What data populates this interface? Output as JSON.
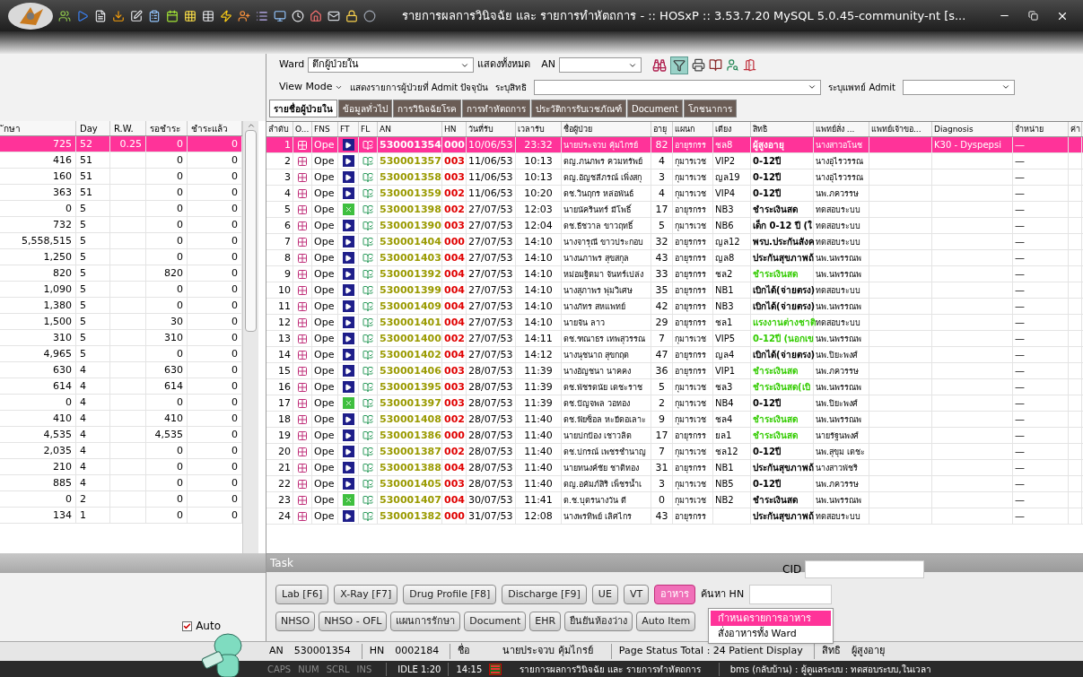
{
  "window": {
    "title": "รายการผลการวินิจฉัย และ รายการทำหัตถการ - :: HOSxP :: 3.53.7.20 MySQL 5.0.45-community-nt [s..."
  },
  "toolbar": {
    "ward_label": "Ward",
    "ward_value": "ตึกผู้ป่วยใน",
    "show_all": "แสดงทั้งหมด",
    "an_label": "AN",
    "filter_on": true,
    "view_mode": "View Mode",
    "admit_current": "แสดงรายการผู้ป่วยที่ Admit ปัจจุบัน",
    "right_label": "ระบุสิทธิ",
    "doctor_label": "ระบุแพทย์ Admit"
  },
  "tabs": [
    {
      "label": "รายชื่อผู้ป่วยใน",
      "selected": true
    },
    {
      "label": "ข้อมูลทั่วไป",
      "selected": false
    },
    {
      "label": "การวินิจฉัยโรค",
      "selected": false
    },
    {
      "label": "การทำหัตถการ",
      "selected": false
    },
    {
      "label": "ประวัติการรับเวชภัณฑ์",
      "selected": false
    },
    {
      "label": "Document",
      "selected": false
    },
    {
      "label": "โภชนาการ",
      "selected": false
    }
  ],
  "left_table": {
    "columns": [
      "ักษา",
      "Day",
      "R.W.",
      "รอชำระ",
      "ชำระแล้ว"
    ],
    "rows": [
      {
        "selected": true,
        "cells": [
          "725",
          "52",
          "0.25",
          "0",
          "0"
        ]
      },
      {
        "selected": false,
        "cells": [
          "416",
          "51",
          "",
          "0",
          "0"
        ]
      },
      {
        "selected": false,
        "cells": [
          "160",
          "51",
          "",
          "0",
          "0"
        ]
      },
      {
        "selected": false,
        "cells": [
          "363",
          "51",
          "",
          "0",
          "0"
        ]
      },
      {
        "selected": false,
        "cells": [
          "0",
          "5",
          "",
          "0",
          "0"
        ]
      },
      {
        "selected": false,
        "cells": [
          "732",
          "5",
          "",
          "0",
          "0"
        ]
      },
      {
        "selected": false,
        "cells": [
          "5,558,515",
          "5",
          "",
          "0",
          "0"
        ]
      },
      {
        "selected": false,
        "cells": [
          "1,250",
          "5",
          "",
          "0",
          "0"
        ]
      },
      {
        "selected": false,
        "cells": [
          "820",
          "5",
          "",
          "820",
          "0"
        ]
      },
      {
        "selected": false,
        "cells": [
          "1,090",
          "5",
          "",
          "0",
          "0"
        ]
      },
      {
        "selected": false,
        "cells": [
          "1,380",
          "5",
          "",
          "0",
          "0"
        ]
      },
      {
        "selected": false,
        "cells": [
          "1,500",
          "5",
          "",
          "30",
          "0"
        ]
      },
      {
        "selected": false,
        "cells": [
          "310",
          "5",
          "",
          "310",
          "0"
        ]
      },
      {
        "selected": false,
        "cells": [
          "4,965",
          "5",
          "",
          "0",
          "0"
        ]
      },
      {
        "selected": false,
        "cells": [
          "630",
          "4",
          "",
          "630",
          "0"
        ]
      },
      {
        "selected": false,
        "cells": [
          "614",
          "4",
          "",
          "614",
          "0"
        ]
      },
      {
        "selected": false,
        "cells": [
          "0",
          "4",
          "",
          "0",
          "0"
        ]
      },
      {
        "selected": false,
        "cells": [
          "410",
          "4",
          "",
          "410",
          "0"
        ]
      },
      {
        "selected": false,
        "cells": [
          "4,535",
          "4",
          "",
          "4,535",
          "0"
        ]
      },
      {
        "selected": false,
        "cells": [
          "2,035",
          "4",
          "",
          "0",
          "0"
        ]
      },
      {
        "selected": false,
        "cells": [
          "210",
          "4",
          "",
          "0",
          "0"
        ]
      },
      {
        "selected": false,
        "cells": [
          "885",
          "4",
          "",
          "0",
          "0"
        ]
      },
      {
        "selected": false,
        "cells": [
          "0",
          "2",
          "",
          "0",
          "0"
        ]
      },
      {
        "selected": false,
        "cells": [
          "134",
          "1",
          "",
          "0",
          "0"
        ]
      }
    ]
  },
  "table": {
    "columns": [
      "ลำดับ",
      "O...",
      "FNS",
      "FT",
      "FL",
      "AN",
      "HN",
      "วันที่รับ",
      "เวลารับ",
      "ชื่อผู้ป่วย",
      "อายุ",
      "แผนก",
      "เตียง",
      "สิทธิ",
      "แพทย์สั่ง ...",
      "แพทย์เจ้าขอ...",
      "Diagnosis",
      "จำหน่าย",
      "ค่า"
    ],
    "rows": [
      {
        "selected": true,
        "kind": "play",
        "no": "1",
        "fns": "Ope",
        "an": "530001354",
        "hn": "000",
        "date": "10/06/53",
        "time": "23:32",
        "name": "นายประจวบ คุ้มไกรย์",
        "age": "82",
        "dept": "อายุรกรร",
        "bed": "ชล8",
        "right": "ผู้สูงอายุ",
        "doctor": "นางสาวอโนช",
        "diagnosis": "K30 - Dyspepsi",
        "discharge": "—"
      },
      {
        "selected": false,
        "kind": "play",
        "no": "2",
        "fns": "Ope",
        "an": "530001357",
        "hn": "003",
        "date": "11/06/53",
        "time": "10:13",
        "name": "ดญ.ภนภพร ควมทรัพย์",
        "age": "4",
        "dept": "กุมารเวช",
        "bed": "VIP2",
        "right": "0-12ปี",
        "color": "#000000",
        "doctor": "นางอุไรวรรณ",
        "discharge": "—"
      },
      {
        "selected": false,
        "kind": "play",
        "no": "3",
        "fns": "Ope",
        "an": "530001358",
        "hn": "003",
        "date": "11/06/53",
        "time": "10:13",
        "name": "ดญ.อัญชลีภรณ์ เพิ่งสกุ",
        "age": "3",
        "dept": "กุมารเวช",
        "bed": "ญล19",
        "right": "0-12ปี",
        "color": "#000000",
        "doctor": "นางอุไรวรรณ",
        "discharge": "—"
      },
      {
        "selected": false,
        "kind": "play",
        "no": "4",
        "fns": "Ope",
        "an": "530001359",
        "hn": "002",
        "date": "11/06/53",
        "time": "10:20",
        "name": "ดช.วินฤกร หล่อพันธ์",
        "age": "4",
        "dept": "กุมารเวช",
        "bed": "VIP4",
        "right": "0-12ปี",
        "color": "#000000",
        "doctor": "นพ.ภควรรษ",
        "discharge": "—"
      },
      {
        "selected": false,
        "kind": "cross",
        "no": "5",
        "fns": "Ope",
        "an": "530001398",
        "hn": "002",
        "date": "27/07/53",
        "time": "12:03",
        "name": "นายนัครินทร์ มีโพธิ์",
        "age": "17",
        "dept": "อายุรกรร",
        "bed": "NB3",
        "right": "ชำระเงินสด",
        "color": "#000000",
        "doctor": "ทดสอบระบบ",
        "discharge": "—"
      },
      {
        "selected": false,
        "kind": "play",
        "no": "6",
        "fns": "Ope",
        "an": "530001390",
        "hn": "003",
        "date": "27/07/53",
        "time": "12:04",
        "name": "ดช.ธีชวาล ขาวฤทธิ์",
        "age": "5",
        "dept": "กุมารเวช",
        "bed": "NB6",
        "right": "เด็ก 0-12 ปี (ใ",
        "color": "#000000",
        "doctor": "ทดสอบระบบ",
        "discharge": "—"
      },
      {
        "selected": false,
        "kind": "play",
        "no": "7",
        "fns": "Ope",
        "an": "530001404",
        "hn": "000",
        "date": "27/07/53",
        "time": "14:10",
        "name": "นางจารุณี ขาวประกอบ",
        "age": "32",
        "dept": "อายุรกรร",
        "bed": "ญล12",
        "right": "พรบ.ประกันสังค",
        "color": "#000000",
        "doctor": "ทดสอบระบบ",
        "discharge": "—"
      },
      {
        "selected": false,
        "kind": "play",
        "no": "8",
        "fns": "Ope",
        "an": "530001403",
        "hn": "004",
        "date": "27/07/53",
        "time": "14:10",
        "name": "นางนภาพร สุขสกุล",
        "age": "43",
        "dept": "อายุรกรร",
        "bed": "ญล8",
        "right": "ประกันสุขภาพถ้",
        "color": "#000000",
        "doctor": "นพ.นพรรณพ",
        "discharge": "—"
      },
      {
        "selected": false,
        "kind": "play",
        "no": "9",
        "fns": "Ope",
        "an": "530001392",
        "hn": "004",
        "date": "27/07/53",
        "time": "14:10",
        "name": "หม่อมฐิตมา จันทร์เปล่ง",
        "age": "33",
        "dept": "อายุรกรร",
        "bed": "ชล2",
        "right": "ชำระเงินสด",
        "color": "#33cc00",
        "doctor": "นพ.นพรรณพ",
        "discharge": "—"
      },
      {
        "selected": false,
        "kind": "play",
        "no": "10",
        "fns": "Ope",
        "an": "530001399",
        "hn": "004",
        "date": "27/07/53",
        "time": "14:10",
        "name": "นางสุภาพร พุ่มวิเศษ",
        "age": "35",
        "dept": "อายุรกรร",
        "bed": "NB1",
        "right": "เบิกได้(จ่ายตรง)",
        "color": "#000000",
        "doctor": "ทดสอบระบบ",
        "discharge": "—"
      },
      {
        "selected": false,
        "kind": "play",
        "no": "11",
        "fns": "Ope",
        "an": "530001409",
        "hn": "004",
        "date": "27/07/53",
        "time": "14:10",
        "name": "นางภัทร สหแพทย์",
        "age": "42",
        "dept": "อายุรกรร",
        "bed": "NB3",
        "right": "เบิกได้(จ่ายตรง)",
        "color": "#000000",
        "doctor": "นพ.นพรรณพ",
        "discharge": "—"
      },
      {
        "selected": false,
        "kind": "play",
        "no": "12",
        "fns": "Ope",
        "an": "530001401",
        "hn": "004",
        "date": "27/07/53",
        "time": "14:10",
        "name": "นายจัน ลาว",
        "age": "29",
        "dept": "อายุรกรร",
        "bed": "ชล1",
        "right": "แรงงานต่างชาติ",
        "color": "#33cc00",
        "doctor": "ทดสอบระบบ",
        "discharge": "—"
      },
      {
        "selected": false,
        "kind": "play",
        "no": "13",
        "fns": "Ope",
        "an": "530001400",
        "hn": "002",
        "date": "27/07/53",
        "time": "14:11",
        "name": "ดช.ฑณาธร เทพสุวรรณ",
        "age": "7",
        "dept": "กุมารเวช",
        "bed": "VIP5",
        "right": "0-12ปี (นอกเข",
        "color": "#33cc00",
        "doctor": "นพ.นพรรณพ",
        "discharge": "—"
      },
      {
        "selected": false,
        "kind": "play",
        "no": "14",
        "fns": "Ope",
        "an": "530001402",
        "hn": "004",
        "date": "27/07/53",
        "time": "14:12",
        "name": "นางนุชนาถ สุขกฤต",
        "age": "47",
        "dept": "อายุรกรร",
        "bed": "ญล4",
        "right": "เบิกได้(จ่ายตรง)",
        "color": "#000000",
        "doctor": "นพ.ปิยะพงศ์",
        "discharge": "—"
      },
      {
        "selected": false,
        "kind": "play",
        "no": "15",
        "fns": "Ope",
        "an": "530001406",
        "hn": "003",
        "date": "28/07/53",
        "time": "11:39",
        "name": "นางอัญชนา นาคคง",
        "age": "36",
        "dept": "อายุรกรร",
        "bed": "VIP1",
        "right": "ชำระเงินสด",
        "color": "#33cc00",
        "doctor": "นพ.ภควรรษ",
        "discharge": "—"
      },
      {
        "selected": false,
        "kind": "play",
        "no": "16",
        "fns": "Ope",
        "an": "530001395",
        "hn": "003",
        "date": "28/07/53",
        "time": "11:39",
        "name": "ดช.พัชรดนัย เดชะราช",
        "age": "5",
        "dept": "กุมารเวช",
        "bed": "ชล3",
        "right": "ชำระเงินสด(เบิ",
        "color": "#33cc00",
        "doctor": "นพ.นพรรณพ",
        "discharge": "—"
      },
      {
        "selected": false,
        "kind": "cross",
        "no": "17",
        "fns": "Ope",
        "an": "530001397",
        "hn": "003",
        "date": "28/07/53",
        "time": "11:39",
        "name": "ดช.ปัญจพล วอทอง",
        "age": "2",
        "dept": "กุมารเวช",
        "bed": "NB4",
        "right": "0-12ปี",
        "color": "#000000",
        "doctor": "นพ.ปิยะพงศ์",
        "discharge": "—"
      },
      {
        "selected": false,
        "kind": "play",
        "no": "18",
        "fns": "Ope",
        "an": "530001408",
        "hn": "002",
        "date": "28/07/53",
        "time": "11:40",
        "name": "ดช.ฟัยซ็อล หะยีดอเลาะ",
        "age": "9",
        "dept": "กุมารเวช",
        "bed": "ชล4",
        "right": "ชำระเงินสด",
        "color": "#33cc00",
        "doctor": "นพ.นพรรณพ",
        "discharge": "—"
      },
      {
        "selected": false,
        "kind": "play",
        "no": "19",
        "fns": "Ope",
        "an": "530001386",
        "hn": "000",
        "date": "28/07/53",
        "time": "11:40",
        "name": "นายปกป้อง เชาวลิต",
        "age": "17",
        "dept": "อายุรกรร",
        "bed": "ยล1",
        "right": "ชำระเงินสด",
        "color": "#33cc00",
        "doctor": "นายรัฐนพงศ์",
        "discharge": "—"
      },
      {
        "selected": false,
        "kind": "play",
        "no": "20",
        "fns": "Ope",
        "an": "530001387",
        "hn": "002",
        "date": "28/07/53",
        "time": "11:40",
        "name": "ดช.ปกรณ์ เพชรชำนาญ",
        "age": "7",
        "dept": "กุมารเวช",
        "bed": "ชล12",
        "right": "0-12ปี",
        "color": "#000000",
        "doctor": "นพ.สุขุม เตชะ",
        "discharge": "—"
      },
      {
        "selected": false,
        "kind": "play",
        "no": "21",
        "fns": "Ope",
        "an": "530001388",
        "hn": "004",
        "date": "28/07/53",
        "time": "11:40",
        "name": "นายทนงค์ชัย ชาติทอง",
        "age": "31",
        "dept": "อายุรกรร",
        "bed": "NB1",
        "right": "ประกันสุขภาพถ้",
        "color": "#000000",
        "doctor": "นางสาวพัชริ",
        "discharge": "—"
      },
      {
        "selected": false,
        "kind": "play",
        "no": "22",
        "fns": "Ope",
        "an": "530001405",
        "hn": "003",
        "date": "28/07/53",
        "time": "11:40",
        "name": "ดญ.อคัมภ์สิริ เพ็ชรน้ำเ",
        "age": "3",
        "dept": "กุมารเวช",
        "bed": "NB5",
        "right": "0-12ปี",
        "color": "#000000",
        "doctor": "นพ.ภควรรษ",
        "discharge": "—"
      },
      {
        "selected": false,
        "kind": "cross",
        "no": "23",
        "fns": "Ope",
        "an": "530001407",
        "hn": "004",
        "date": "30/07/53",
        "time": "11:41",
        "name": "ด.ช.บุตรนางวัน ดี",
        "age": "0",
        "dept": "กุมารเวช",
        "bed": "NB2",
        "right": "ชำระเงินสด",
        "color": "#000000",
        "doctor": "นพ.นพรรณพ",
        "discharge": "—"
      },
      {
        "selected": false,
        "kind": "play",
        "no": "24",
        "fns": "Ope",
        "an": "530001382",
        "hn": "000",
        "date": "31/07/53",
        "time": "12:08",
        "name": "นางพรทิพย์ เลิศไกร",
        "age": "43",
        "dept": "อายุรกรร",
        "right": "ประกันสุขภาพถ้",
        "color": "#000000",
        "doctor": "ทดสอบระบบ",
        "discharge": "—"
      }
    ]
  },
  "auto_checkbox": {
    "label": "Auto",
    "checked": true
  },
  "task": {
    "title": "Task",
    "cid_label": "CID",
    "search_hn_label": "ค้นหา HN",
    "buttons_row1": [
      {
        "label": "Lab [F6]",
        "selected": false
      },
      {
        "label": "X-Ray [F7]",
        "selected": false
      },
      {
        "label": "Drug Profile [F8]",
        "selected": false
      },
      {
        "label": "Discharge [F9]",
        "selected": false
      },
      {
        "label": "UE",
        "selected": false
      },
      {
        "label": "VT",
        "selected": false
      },
      {
        "label": "อาหาร",
        "selected": true
      }
    ],
    "buttons_row2": [
      {
        "label": "NHSO",
        "selected": false
      },
      {
        "label": "NHSO - OFL",
        "selected": false
      },
      {
        "label": "แผนการรักษา",
        "selected": false
      },
      {
        "label": "Document",
        "selected": false
      },
      {
        "label": "EHR",
        "selected": false
      },
      {
        "label": "ยืนยันห้องว่าง",
        "selected": false
      },
      {
        "label": "Auto Item",
        "selected": false
      }
    ],
    "menu": [
      {
        "label": "กำหนดรายการอาหาร",
        "selected": true
      },
      {
        "label": "สั่งอาหารทั้ง Ward",
        "selected": false
      }
    ]
  },
  "patient_bar": {
    "an_label": "AN",
    "an": "530001354",
    "hn_label": "HN",
    "hn": "0002184",
    "name_label": "ชื่อ",
    "name": "นายประจวบ คุ้มไกรย์",
    "page_status": "Page Status Total : 24 Patient Display",
    "right_label": "สิทธิ",
    "right": "ผู้สูงอายุ"
  },
  "status_bar": {
    "keys": [
      "CAPS",
      "NUM",
      "SCRL",
      "INS"
    ],
    "idle": "IDLE 1:20",
    "time": "14:15",
    "screen": "รายการผลการวินิจฉัย และ รายการทำหัตถการ",
    "user": "bms (กลับบ้าน) : ผู้ดูแลระบบ : ทดสอบระบบ,ในเวลา"
  }
}
